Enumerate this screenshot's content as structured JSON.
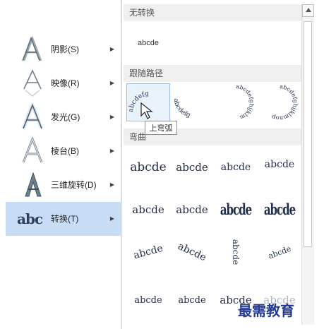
{
  "left_menu": {
    "items": [
      {
        "label": "阴影(S)",
        "icon": "shadow-a-icon",
        "selected": false
      },
      {
        "label": "映像(R)",
        "icon": "reflection-a-icon",
        "selected": false
      },
      {
        "label": "发光(G)",
        "icon": "glow-a-icon",
        "selected": false
      },
      {
        "label": "棱台(B)",
        "icon": "bevel-a-icon",
        "selected": false
      },
      {
        "label": "三维旋转(D)",
        "icon": "3d-rotation-a-icon",
        "selected": false
      },
      {
        "label": "转换(T)",
        "icon": "transform-abc-icon",
        "selected": true
      }
    ],
    "transform_logo": "abc"
  },
  "gallery": {
    "sections": {
      "no_transform": "无转换",
      "follow_path": "跟随路径",
      "warp": "弯曲"
    },
    "no_transform_sample": "abcde",
    "path_samples": [
      {
        "text": "abcdefg",
        "style": "arch-up"
      },
      {
        "text": "abcdefg",
        "style": "arch-down"
      },
      {
        "text": "abcdefghijklm",
        "style": "circle"
      },
      {
        "text": "abcdefghijklmnop",
        "style": "button"
      }
    ],
    "warp_samples": [
      "abcde",
      "abcde",
      "abcde",
      "abcde",
      "abcde",
      "abcde",
      "abcde",
      "abcde",
      "abcde",
      "abcde",
      "abcde",
      "abcde",
      "abcde",
      "abcde",
      "abcde",
      "abcde"
    ],
    "hovered_tooltip": "上弯弧"
  },
  "watermark": "最需教育",
  "colors": {
    "selected_bg": "#c7dcf5",
    "text_effect": "#1f2c4a"
  }
}
